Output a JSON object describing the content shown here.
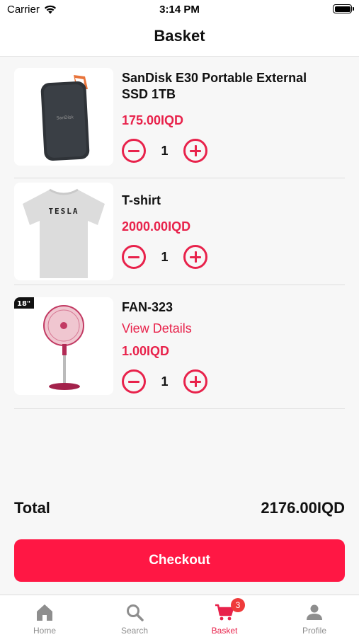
{
  "status_bar": {
    "carrier": "Carrier",
    "time": "3:14 PM"
  },
  "header": {
    "title": "Basket"
  },
  "items": [
    {
      "name": "SanDisk E30 Portable External SSD 1TB",
      "price": "175.00IQD",
      "quantity": "1",
      "image_icon": "ssd-drive"
    },
    {
      "name": "T-shirt",
      "price": "2000.00IQD",
      "quantity": "1",
      "image_icon": "tshirt",
      "print_text": "TESLA"
    },
    {
      "name": "FAN-323",
      "link": "View Details",
      "price": "1.00IQD",
      "quantity": "1",
      "image_icon": "stand-fan",
      "image_tag": "18\""
    }
  ],
  "summary": {
    "total_label": "Total",
    "total_value": "2176.00IQD"
  },
  "checkout": {
    "label": "Checkout"
  },
  "tabs": [
    {
      "label": "Home",
      "icon": "home-icon",
      "active": false
    },
    {
      "label": "Search",
      "icon": "search-icon",
      "active": false
    },
    {
      "label": "Basket",
      "icon": "cart-icon",
      "active": true,
      "badge": "3"
    },
    {
      "label": "Profile",
      "icon": "person-icon",
      "active": false
    }
  ],
  "colors": {
    "accent": "#e8224b",
    "checkout_bg": "#ff1744",
    "inactive_tab": "#8e8e8e"
  }
}
